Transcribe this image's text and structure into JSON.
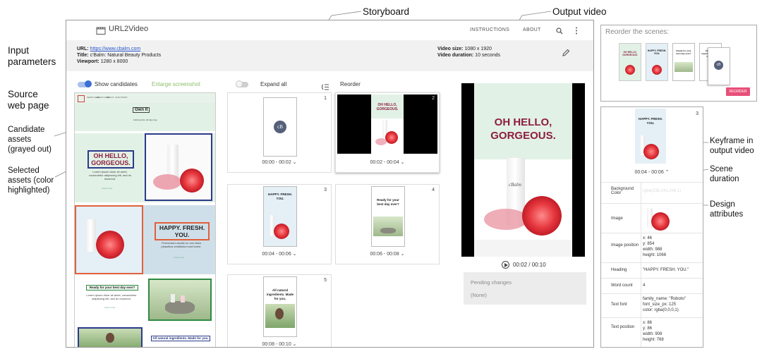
{
  "annotations": {
    "storyboard": "Storyboard",
    "output_video": "Output video",
    "input_parameters": "Input\nparameters",
    "source_web_page": "Source\nweb page",
    "candidate_assets": "Candidate\nassets\n(grayed out)",
    "selected_assets": "Selected\nassets (color\nhighlighted)",
    "keyframe": "Keyframe in\noutput video",
    "scene_duration": "Scene\nduration",
    "design_attributes": "Design\nattributes"
  },
  "app": {
    "name": "URL2Video",
    "nav_instructions": "INSTRUCTIONS",
    "nav_about": "ABOUT"
  },
  "params": {
    "url_label": "URL:",
    "url_value": "https://www.cbalm.com",
    "title_label": "Title:",
    "title_value": "c'Balm: Natural Beauty Products",
    "viewport_label": "Viewport:",
    "viewport_value": "1280 x 8000",
    "video_size_label": "Video size:",
    "video_size_value": "1080 x 1920",
    "video_duration_label": "Video duration:",
    "video_duration_value": "10 seconds"
  },
  "controls": {
    "show_candidates": "Show candidates",
    "enlarge_screenshot": "Enlarge screenshot",
    "expand_all": "Expand all",
    "reorder": "Reorder"
  },
  "source_page": {
    "nav_items": [
      "SHOP CARE",
      "SHOP CARE",
      "ABOUT",
      "OUR STORY"
    ],
    "own_it": "Own It",
    "hero_sub": "Adoring skin, all day long.",
    "hello_heading": "OH HELLO, GORGEOUS.",
    "lorem1": "Lorem ipsum dolor sit amet, consectetur adipiscing elit, sed do eiusmod.",
    "learn_more": "Learn more",
    "happy_heading": "HAPPY. FRESH. YOU.",
    "fermentum": "Fermentum iaculis eu non diam phasellus vestibulum sed lorem.",
    "ready_heading": "Ready for your best day ever?",
    "lorem2": "Lorem ipsum dolor sit amet, consectetur adipiscing elit, sed do eiusmod.",
    "natural_heading": "All natural ingredients. Made for you."
  },
  "scenes": [
    {
      "num": "1",
      "time": "00:00 - 00:02"
    },
    {
      "num": "2",
      "time": "00:02 - 00:04",
      "heading": "OH HELLO, GORGEOUS."
    },
    {
      "num": "3",
      "time": "00:04 - 00:06",
      "heading": "HAPPY. FRESH. YOU."
    },
    {
      "num": "4",
      "time": "00:06 - 00:08",
      "heading": "Ready for your best day ever?"
    },
    {
      "num": "5",
      "time": "00:08 - 00:10",
      "heading": "All natural ingredients. Made for you."
    }
  ],
  "player": {
    "heading": "OH HELLO, GORGEOUS.",
    "brand": "cBalm",
    "time": "00:02 / 00:10",
    "pending_title": "Pending changes",
    "pending_value": "(None)"
  },
  "reorder_panel": {
    "title": "Reorder the scenes:",
    "button": "REORDER"
  },
  "detail_panel": {
    "num": "3",
    "heading": "HAPPY. FRESH. YOU.",
    "time": "00:04 - 00:06",
    "attrs": [
      {
        "key": "Background Color",
        "val": "rgba(238,241,248,1)"
      },
      {
        "key": "Image",
        "val": ""
      },
      {
        "key": "Image position",
        "val": "x: 46\ny: 854\nwidth: 988\nheight: 1066"
      },
      {
        "key": "Heading",
        "val": "\"HAPPY. FRESH. YOU.\""
      },
      {
        "key": "Word count",
        "val": "4"
      },
      {
        "key": "Text font",
        "val": "family_name: \"Roboto\"\nfont_size_px: 125\ncolor: rgba(0,0,0,1)"
      },
      {
        "key": "Text position",
        "val": "x: 86\ny: 86\nwidth: 908\nheight: 768"
      }
    ]
  },
  "colors": {
    "accent_blue": "#3b6fd4",
    "heading_maroon": "#8c1d3f",
    "mint": "#e2f1e6",
    "select_orange": "#e0603a",
    "select_green": "#2f8a43",
    "select_navy": "#2b3a8a",
    "reorder_pink": "#e84f79"
  }
}
